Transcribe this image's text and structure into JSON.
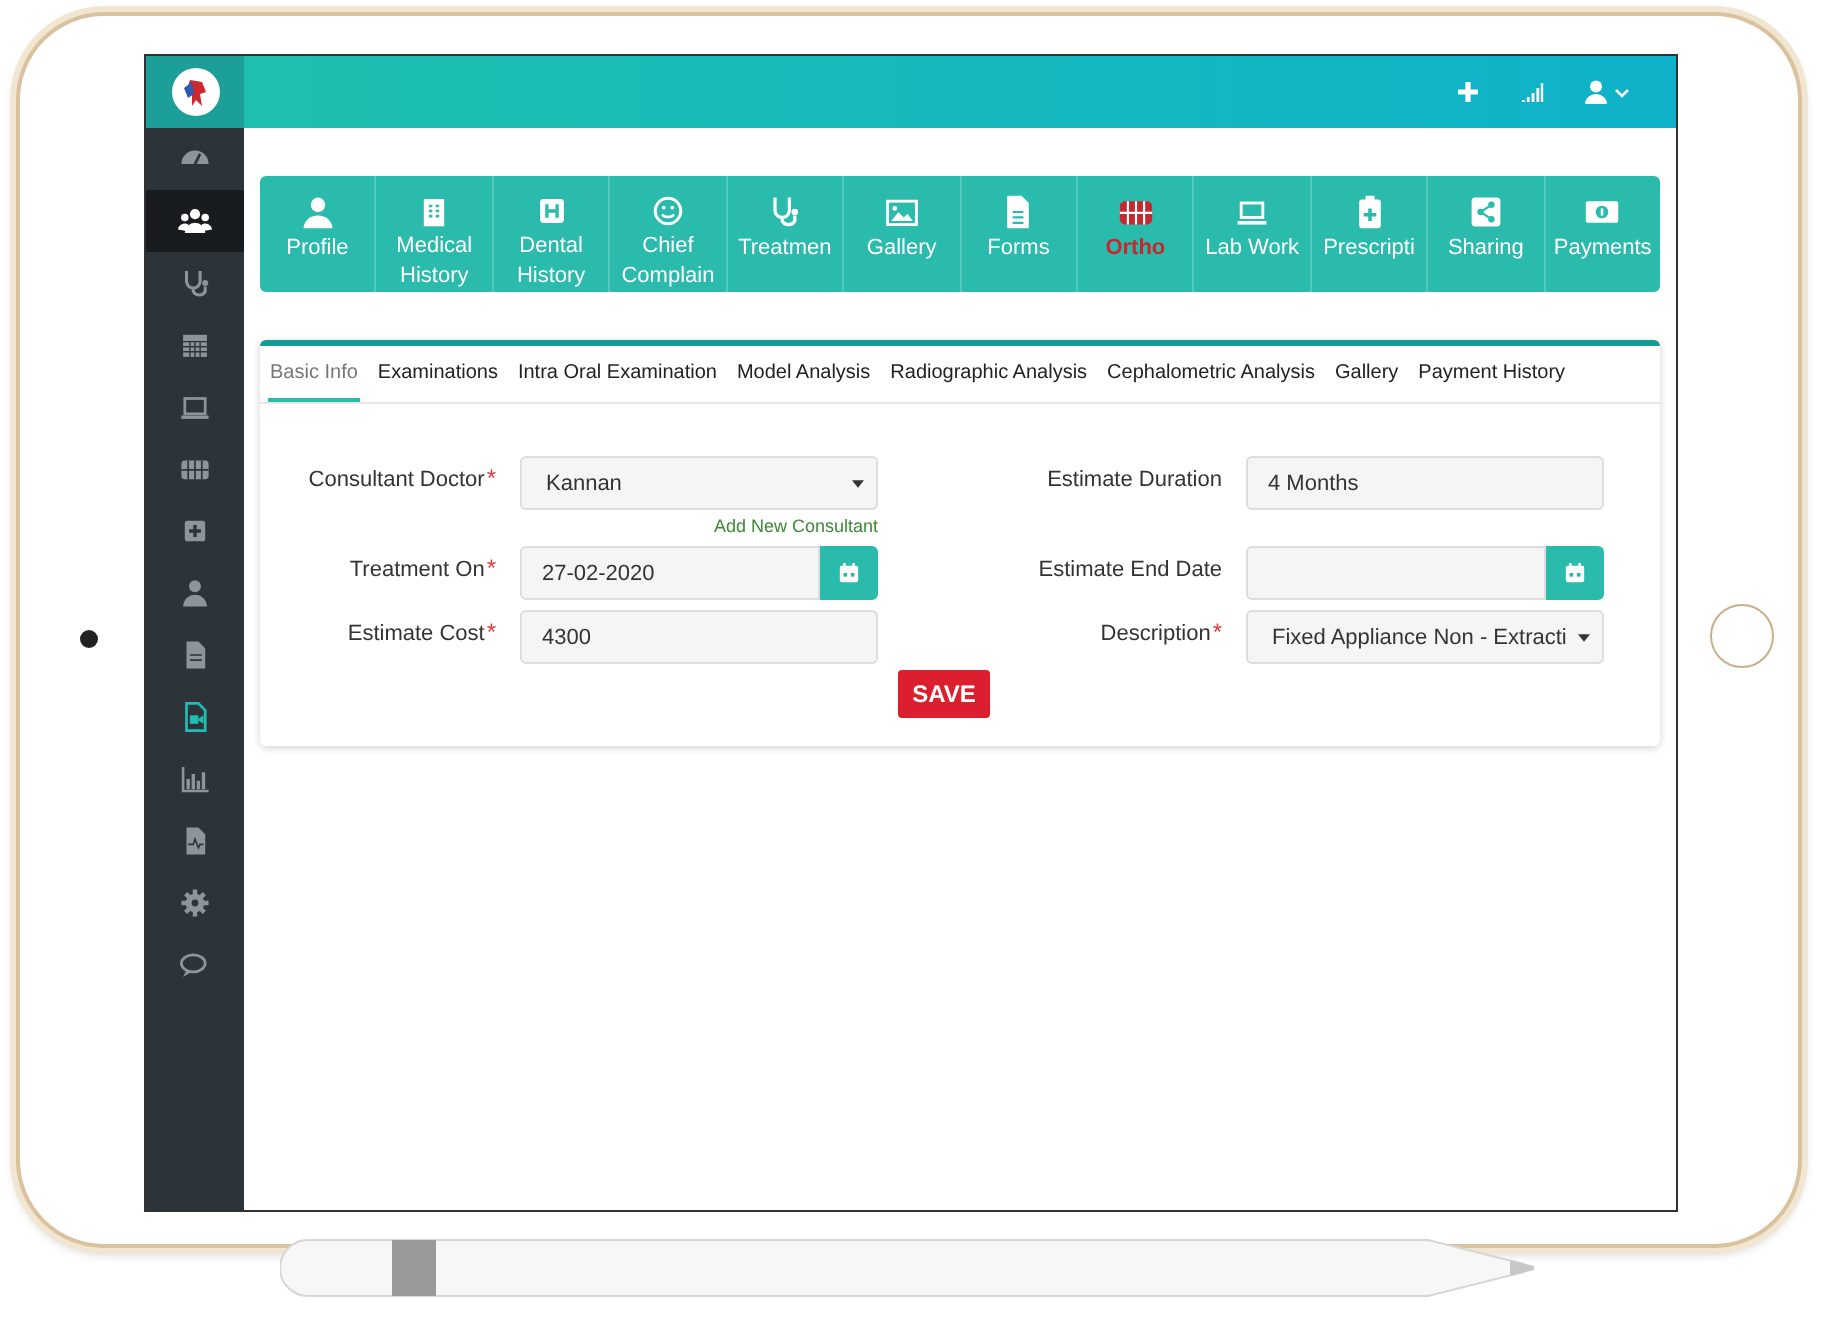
{
  "sidebar": {
    "items": [
      {
        "selected": false,
        "current": false
      },
      {
        "selected": true,
        "current": false
      },
      {
        "selected": false,
        "current": false
      },
      {
        "selected": false,
        "current": false
      },
      {
        "selected": false,
        "current": false
      },
      {
        "selected": false,
        "current": false
      },
      {
        "selected": false,
        "current": false
      },
      {
        "selected": false,
        "current": false
      },
      {
        "selected": false,
        "current": false
      },
      {
        "selected": false,
        "current": true
      },
      {
        "selected": false,
        "current": false
      },
      {
        "selected": false,
        "current": false
      },
      {
        "selected": false,
        "current": false
      },
      {
        "selected": false,
        "current": false
      }
    ]
  },
  "modules": [
    {
      "label": "Profile",
      "selected": false
    },
    {
      "label": "Medical History",
      "selected": false
    },
    {
      "label": "Dental History",
      "selected": false
    },
    {
      "label": "Chief Complain",
      "selected": false
    },
    {
      "label": "Treatmen",
      "selected": false
    },
    {
      "label": "Gallery",
      "selected": false
    },
    {
      "label": "Forms",
      "selected": false
    },
    {
      "label": "Ortho",
      "selected": true
    },
    {
      "label": "Lab Work",
      "selected": false
    },
    {
      "label": "Prescripti",
      "selected": false
    },
    {
      "label": "Sharing",
      "selected": false
    },
    {
      "label": "Payments",
      "selected": false
    }
  ],
  "tabs": [
    {
      "label": "Basic Info",
      "selected": true
    },
    {
      "label": "Examinations",
      "selected": false
    },
    {
      "label": "Intra Oral Examination",
      "selected": false
    },
    {
      "label": "Model Analysis",
      "selected": false
    },
    {
      "label": "Radiographic Analysis",
      "selected": false
    },
    {
      "label": "Cephalometric Analysis",
      "selected": false
    },
    {
      "label": "Gallery",
      "selected": false
    },
    {
      "label": "Payment History",
      "selected": false
    }
  ],
  "form": {
    "fields": [
      {
        "label": "Consultant Doctor",
        "mark": "*",
        "kind": "select",
        "value": "Kannan",
        "link": "Add New Consultant"
      },
      {
        "label": "Estimate Duration",
        "kind": "text",
        "value": "4 Months"
      },
      {
        "label": "Treatment On",
        "mark": "*",
        "kind": "date",
        "value": "27-02-2020"
      },
      {
        "label": "Estimate End Date",
        "kind": "date"
      },
      {
        "label": "Estimate Cost",
        "mark": "*",
        "kind": "text",
        "value": "4300"
      },
      {
        "label": "Description",
        "mark": "*",
        "kind": "select",
        "value": "Fixed Appliance Non - Extracti"
      }
    ],
    "save_button": "SAVE"
  }
}
